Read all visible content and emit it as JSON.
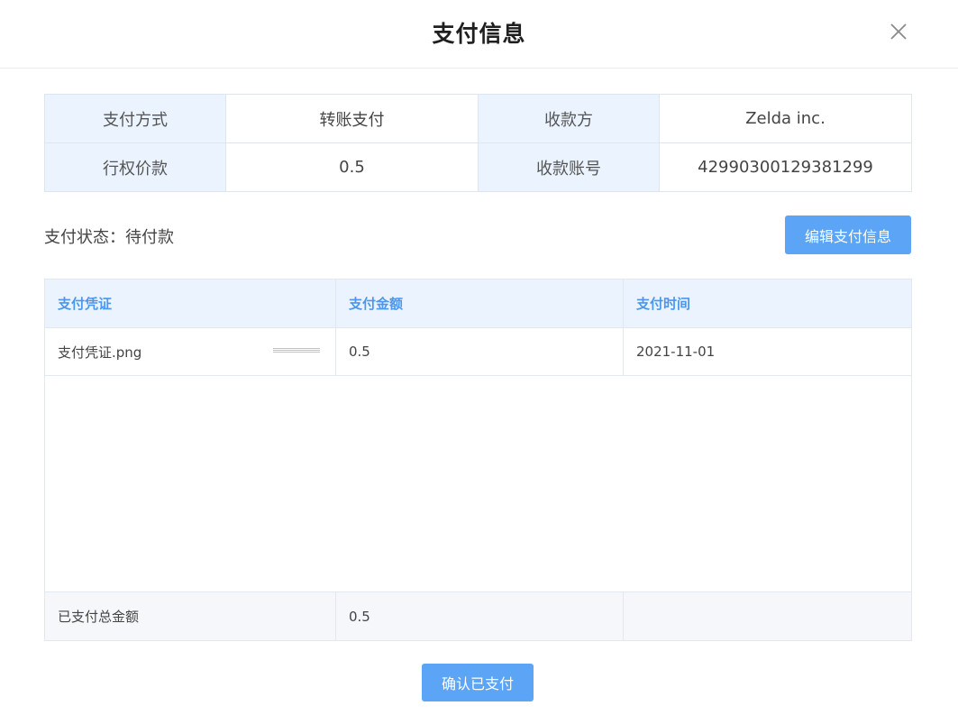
{
  "dialog": {
    "title": "支付信息",
    "close_icon": "close-icon"
  },
  "info": {
    "method_label": "支付方式",
    "method_value": "转账支付",
    "payee_label": "收款方",
    "payee_value": "Zelda inc.",
    "price_label": "行权价款",
    "price_value": "0.5",
    "account_label": "收款账号",
    "account_value": "42990300129381299"
  },
  "status": {
    "text": "支付状态：待付款"
  },
  "edit_button": "编辑支付信息",
  "payments": {
    "columns": [
      "支付凭证",
      "支付金额",
      "支付时间"
    ],
    "rows": [
      {
        "file": "支付凭证.png",
        "amount": "0.5",
        "time": "2021-11-01"
      }
    ],
    "total_label": "已支付总金额",
    "total_value": "0.5"
  },
  "confirm_button": "确认已支付",
  "colors": {
    "accent": "#5ba4f6",
    "header_bg": "#eaf3fe",
    "header_text": "#4a97f0"
  }
}
